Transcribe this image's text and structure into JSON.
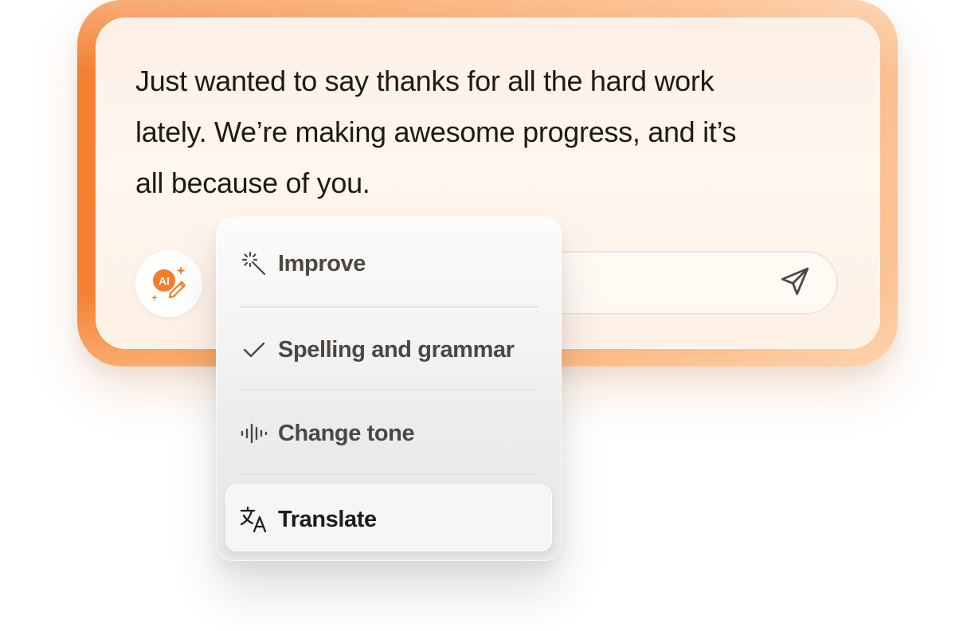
{
  "message": {
    "lines": [
      "Just wanted to say thanks for all the hard work",
      "lately. We’re making awesome progress, and it’s",
      "all because of you."
    ]
  },
  "ai_button": {
    "badge": "AI",
    "icon": "ai-pencil-sparkle-icon"
  },
  "send_button": {
    "icon": "send-icon"
  },
  "menu": {
    "items": [
      {
        "label": "Improve",
        "icon": "magic-wand-icon",
        "selected": false
      },
      {
        "label": "Spelling and grammar",
        "icon": "checkmark-icon",
        "selected": false
      },
      {
        "label": "Change tone",
        "icon": "waveform-icon",
        "selected": false
      },
      {
        "label": "Translate",
        "icon": "translate-icon",
        "selected": true
      }
    ]
  },
  "colors": {
    "accent": "#f47e2e",
    "accent_light": "#fcc79a",
    "text": "#1d1a17",
    "menu_text": "#4a4744"
  }
}
